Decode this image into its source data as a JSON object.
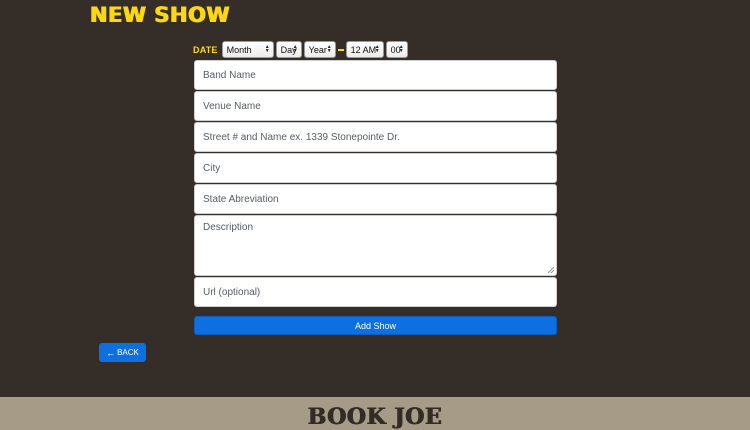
{
  "page_title": "NEW SHOW",
  "date": {
    "label": "DATE",
    "month": "Month",
    "day": "Day",
    "year": "Year",
    "hour": "12 AM",
    "minute": "00"
  },
  "form": {
    "band_name_placeholder": "Band Name",
    "venue_name_placeholder": "Venue Name",
    "street_placeholder": "Street # and Name ex. 1339 Stonepointe Dr.",
    "city_placeholder": "City",
    "state_placeholder": "State Abreviation",
    "description_placeholder": "Description",
    "url_placeholder": "Url (optional)"
  },
  "add_show_label": "Add Show",
  "back_label": "BACK",
  "footer_logo": "BOOK JOE",
  "icons": {
    "back": "arrow-left-icon",
    "select": "up-down-arrows-icon"
  },
  "colors": {
    "background": "#342d28",
    "accent_yellow": "#ffd710",
    "button_blue": "#0d6fe0",
    "footer": "#a69b86"
  }
}
